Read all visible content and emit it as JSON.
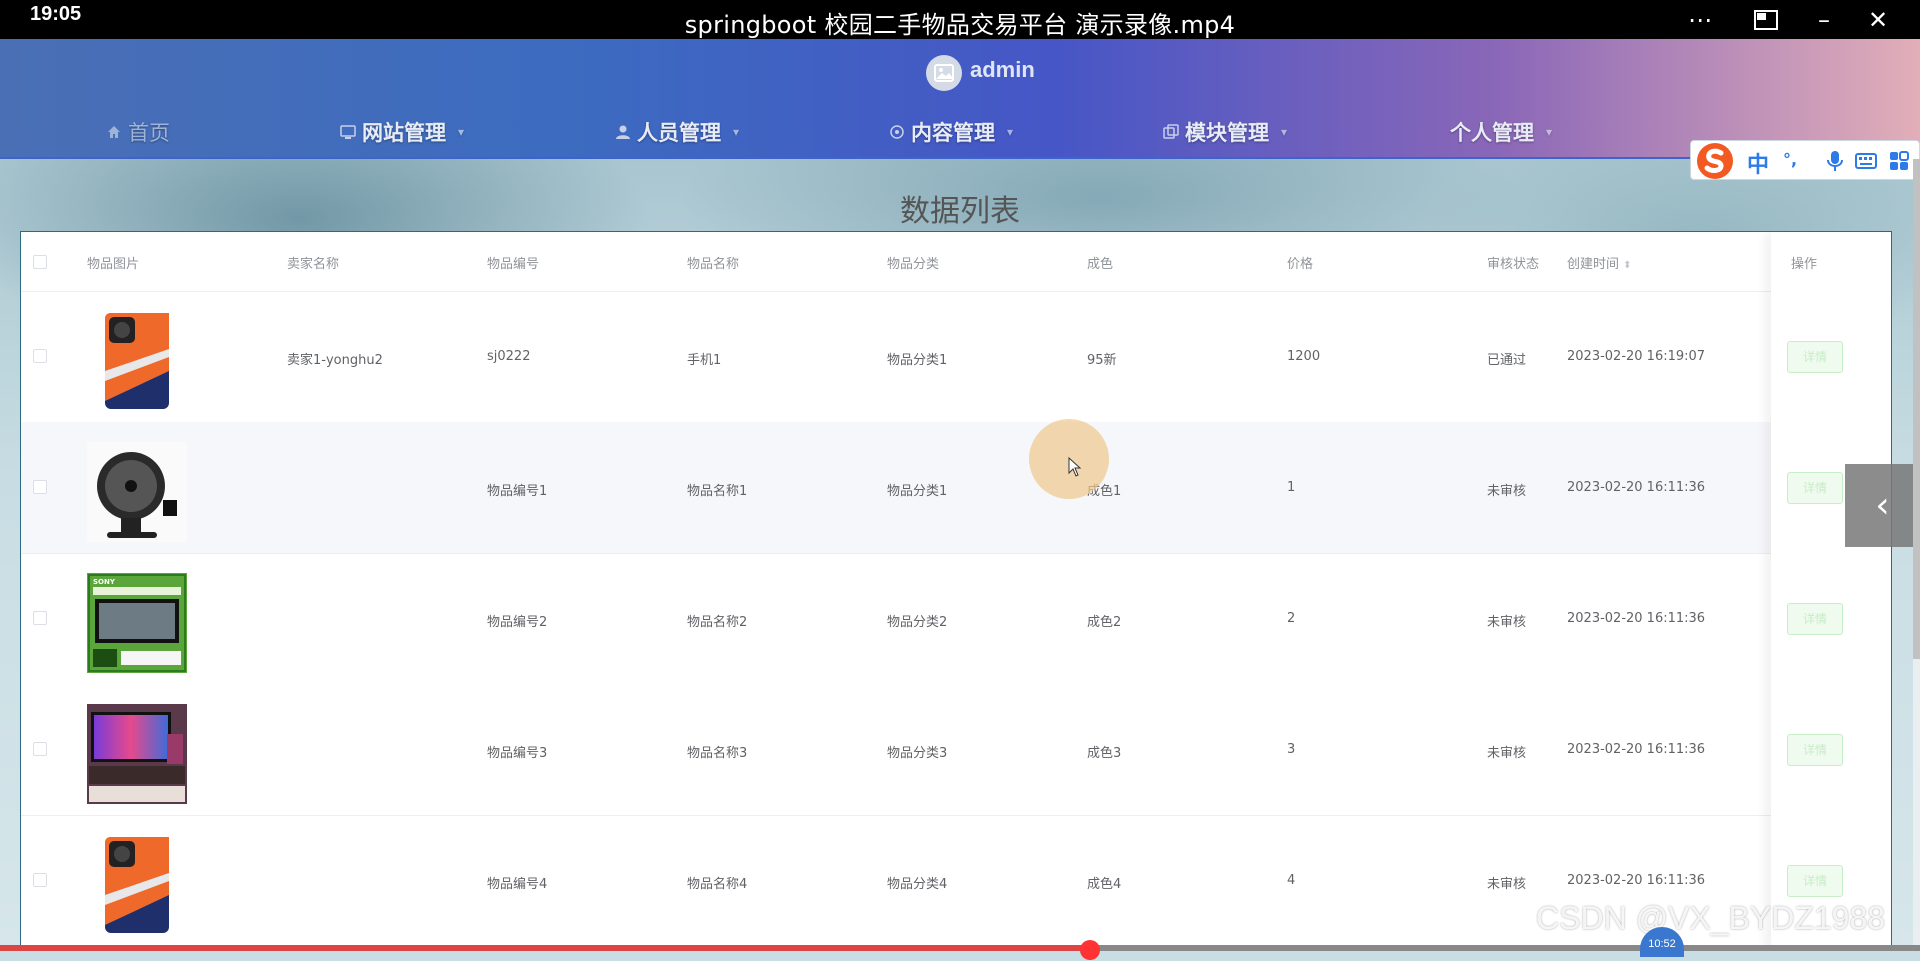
{
  "video": {
    "clock": "19:05",
    "title": "springboot 校园二手物品交易平台 演示录像.mp4"
  },
  "header": {
    "username": "admin",
    "nav": [
      {
        "label": "首页",
        "icon": "home-icon"
      },
      {
        "label": "网站管理",
        "icon": "monitor-icon"
      },
      {
        "label": "人员管理",
        "icon": "user-icon"
      },
      {
        "label": "内容管理",
        "icon": "chat-icon"
      },
      {
        "label": "模块管理",
        "icon": "module-icon"
      },
      {
        "label": "个人管理",
        "icon": ""
      }
    ]
  },
  "page": {
    "title": "数据列表"
  },
  "table": {
    "columns": [
      "物品图片",
      "卖家名称",
      "物品编号",
      "物品名称",
      "物品分类",
      "成色",
      "价格",
      "审核状态",
      "创建时间",
      "操作"
    ],
    "rows": [
      {
        "seller": "卖家1-yonghu2",
        "code": "sj0222",
        "name": "手机1",
        "category": "物品分类1",
        "condition": "95新",
        "price": "1200",
        "status": "已通过",
        "created": "2023-02-20 16:19:07",
        "image": "phone"
      },
      {
        "seller": "",
        "code": "物品编号1",
        "name": "物品名称1",
        "category": "物品分类1",
        "condition": "成色1",
        "price": "1",
        "status": "未审核",
        "created": "2023-02-20 16:11:36",
        "image": "fan"
      },
      {
        "seller": "",
        "code": "物品编号2",
        "name": "物品名称2",
        "category": "物品分类2",
        "condition": "成色2",
        "price": "2",
        "status": "未审核",
        "created": "2023-02-20 16:11:36",
        "image": "tv"
      },
      {
        "seller": "",
        "code": "物品编号3",
        "name": "物品名称3",
        "category": "物品分类3",
        "condition": "成色3",
        "price": "3",
        "status": "未审核",
        "created": "2023-02-20 16:11:36",
        "image": "monitor"
      },
      {
        "seller": "",
        "code": "物品编号4",
        "name": "物品名称4",
        "category": "物品分类4",
        "condition": "成色4",
        "price": "4",
        "status": "未审核",
        "created": "2023-02-20 16:11:36",
        "image": "phone"
      }
    ],
    "detail_label": "详情",
    "tv_brand": "SONY"
  },
  "ime": {
    "items": [
      "中",
      "°,"
    ]
  },
  "overlay": {
    "watermark": "CSDN @VX_BYDZ1988",
    "timestamp": "10:52"
  }
}
